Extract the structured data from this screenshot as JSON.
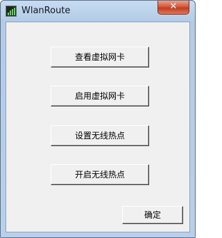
{
  "window": {
    "title": "WlanRoute",
    "close_glyph": "✕",
    "app_icon": "wlan-app-icon"
  },
  "buttons": {
    "view_virtual_nic": "查看虚拟网卡",
    "enable_virtual_nic": "启用虚拟网卡",
    "setup_hotspot": "设置无线热点",
    "start_hotspot": "开启无线热点",
    "ok": "确定"
  },
  "colors": {
    "titlebar": "#b9d0ea",
    "close_button": "#c9472a",
    "client_background": "#f0f0f0"
  }
}
